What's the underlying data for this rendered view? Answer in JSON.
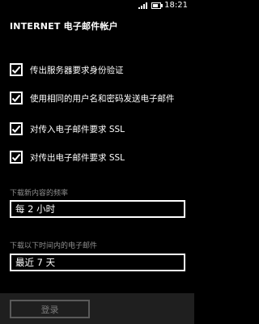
{
  "status": {
    "time": "18:21"
  },
  "title": "INTERNET 电子邮件帐户",
  "options": [
    {
      "label": "传出服务器要求身份验证",
      "checked": true
    },
    {
      "label": "使用相同的用户名和密码发送电子邮件",
      "checked": true
    },
    {
      "label": "对传入电子邮件要求 SSL",
      "checked": true
    },
    {
      "label": "对传出电子邮件要求 SSL",
      "checked": true
    }
  ],
  "download_frequency": {
    "label": "下载新内容的频率",
    "value": "每 2 小时"
  },
  "download_range": {
    "label": "下载以下时间内的电子邮件",
    "value": "最近 7 天"
  },
  "app_bar": {
    "login_label": "登录"
  }
}
